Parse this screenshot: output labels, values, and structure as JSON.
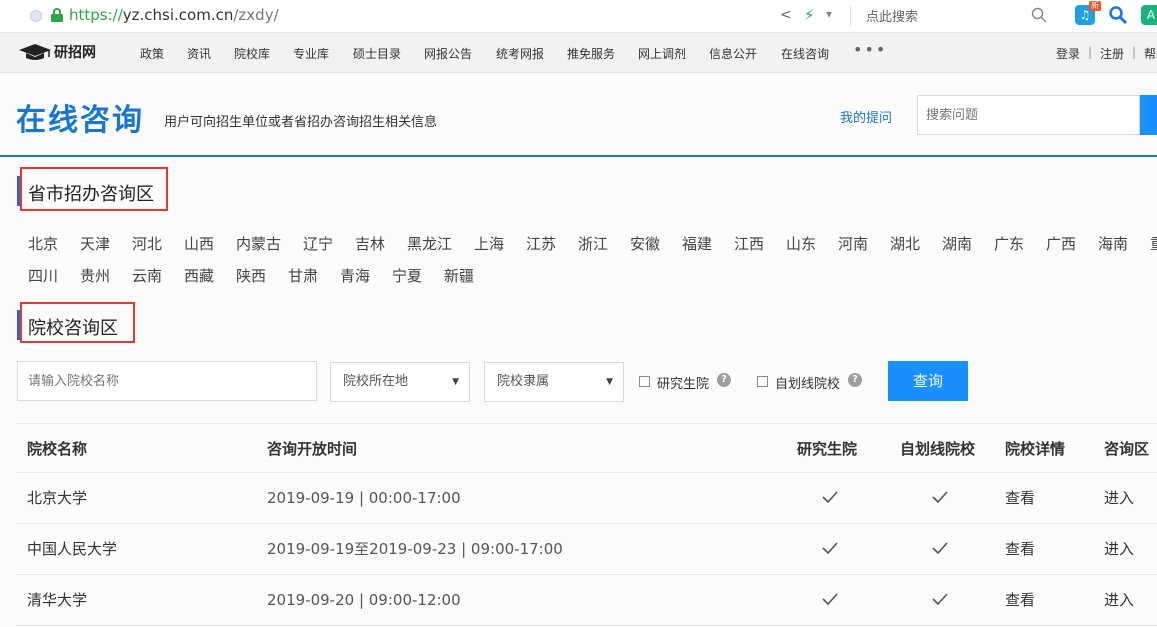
{
  "browser": {
    "url_scheme": "https://",
    "url_host": "yz.chsi.com.cn",
    "url_path": "/zxdy/",
    "search_placeholder": "点此搜索",
    "ext_badge": "新"
  },
  "nav": {
    "logo_text": "研招网",
    "items": [
      "政策",
      "资讯",
      "院校库",
      "专业库",
      "硕士目录",
      "网报公告",
      "统考网报",
      "推免服务",
      "网上调剂",
      "信息公开",
      "在线咨询"
    ],
    "more": "•••",
    "login": "登录",
    "sep": "|",
    "register": "注册",
    "help": "帮助"
  },
  "header": {
    "title": "在线咨询",
    "subtitle": "用户可向招生单位或者省招办咨询招生相关信息",
    "my_questions": "我的提问",
    "search_placeholder": "搜索问题"
  },
  "province_section": {
    "title": "省市招办咨询区",
    "provinces_row1": [
      "北京",
      "天津",
      "河北",
      "山西",
      "内蒙古",
      "辽宁",
      "吉林",
      "黑龙江",
      "上海",
      "江苏",
      "浙江",
      "安徽",
      "福建",
      "江西",
      "山东",
      "河南",
      "湖北",
      "湖南",
      "广东",
      "广西",
      "海南",
      "重庆"
    ],
    "provinces_row2": [
      "四川",
      "贵州",
      "云南",
      "西藏",
      "陕西",
      "甘肃",
      "青海",
      "宁夏",
      "新疆"
    ]
  },
  "school_section": {
    "title": "院校咨询区",
    "name_placeholder": "请输入院校名称",
    "location_select": "院校所在地",
    "affiliation_select": "院校隶属",
    "grad_school_label": "研究生院",
    "self_line_label": "自划线院校",
    "query_button": "查询"
  },
  "table": {
    "headers": {
      "name": "院校名称",
      "time": "咨询开放时间",
      "grad_school": "研究生院",
      "self_line": "自划线院校",
      "details": "院校详情",
      "zone": "咨询区"
    },
    "rows": [
      {
        "name": "北京大学",
        "time": "2019-09-19 | 00:00-17:00",
        "grad_school": true,
        "self_line": true,
        "details": "查看",
        "zone": "进入"
      },
      {
        "name": "中国人民大学",
        "time": "2019-09-19至2019-09-23 | 09:00-17:00",
        "grad_school": true,
        "self_line": true,
        "details": "查看",
        "zone": "进入"
      },
      {
        "name": "清华大学",
        "time": "2019-09-20 | 09:00-12:00",
        "grad_school": true,
        "self_line": true,
        "details": "查看",
        "zone": "进入"
      }
    ]
  },
  "colors": {
    "brand_blue": "#1976d2",
    "button_blue": "#1890ff",
    "highlight_red": "#e53935"
  }
}
